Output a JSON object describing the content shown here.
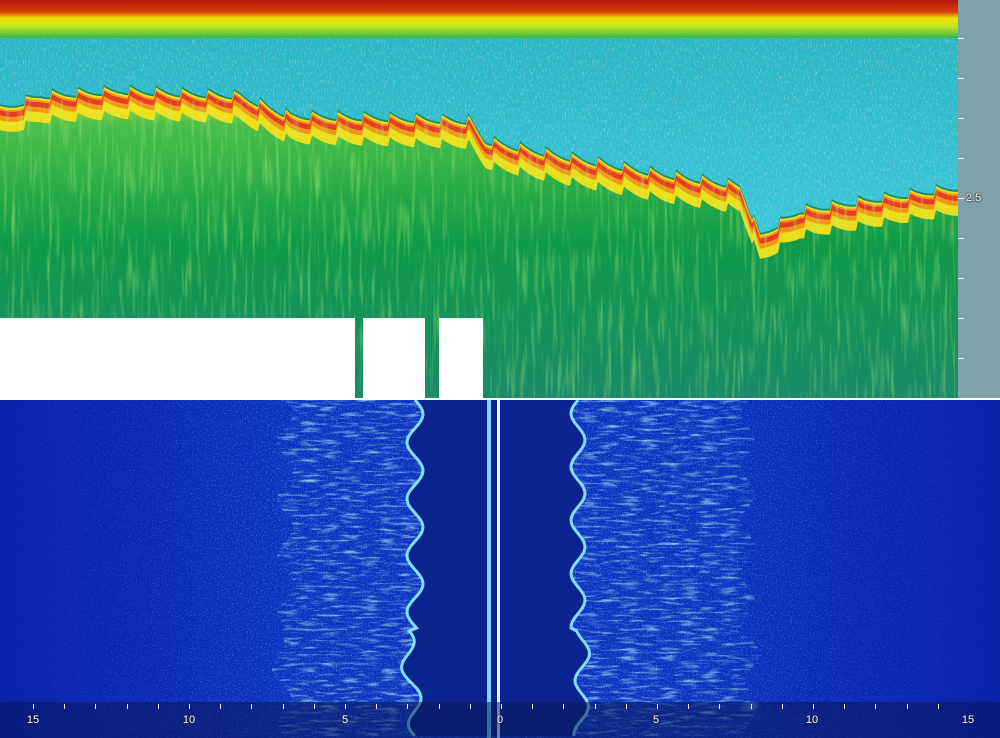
{
  "echogram": {
    "depth_labels": [
      "2.5"
    ],
    "tick_count": 9
  },
  "sidescan": {
    "range_labels": [
      "15",
      "10",
      "5",
      "0",
      "5",
      "10",
      "15"
    ]
  },
  "colors": {
    "echo_water": "#35c9df",
    "echo_bottom": "#f0d000",
    "echo_bottom_edge": "#e2322a",
    "echo_sub": "#0f9e44",
    "echo_surface": "#c01c0c",
    "side_background": "#0b2fb8",
    "side_dark": "#081e8c",
    "side_return": "#6fd7e8"
  }
}
